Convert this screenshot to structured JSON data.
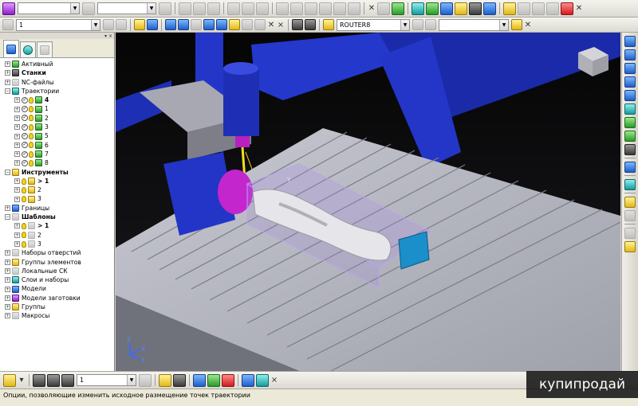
{
  "toolbar_top": {
    "combo_1": "",
    "combo_2": "",
    "combo_3": ""
  },
  "toolbar_second": {
    "level_combo": "1",
    "machine_combo": "ROUTER8",
    "close_glyph": "×"
  },
  "explorer": {
    "header_glyph": "▾ ×",
    "tree": [
      {
        "label": "Активный",
        "bold": false,
        "indent": 0,
        "icon": "active-icon"
      },
      {
        "label": "Станки",
        "bold": true,
        "indent": 0,
        "icon": "machine-icon"
      },
      {
        "label": "NC-файлы",
        "bold": false,
        "indent": 0,
        "icon": "ncfile-icon"
      },
      {
        "label": "Траектории",
        "bold": false,
        "indent": 0,
        "icon": "toolpath-folder-icon",
        "expanded": true
      },
      {
        "label": "4",
        "bold": true,
        "indent": 1,
        "icon": "toolpath-icon"
      },
      {
        "label": "1",
        "bold": false,
        "indent": 1,
        "icon": "toolpath-icon"
      },
      {
        "label": "2",
        "bold": false,
        "indent": 1,
        "icon": "toolpath-icon"
      },
      {
        "label": "3",
        "bold": false,
        "indent": 1,
        "icon": "toolpath-icon"
      },
      {
        "label": "5",
        "bold": false,
        "indent": 1,
        "icon": "toolpath-icon"
      },
      {
        "label": "6",
        "bold": false,
        "indent": 1,
        "icon": "toolpath-icon"
      },
      {
        "label": "7",
        "bold": false,
        "indent": 1,
        "icon": "toolpath-icon"
      },
      {
        "label": "8",
        "bold": false,
        "indent": 1,
        "icon": "toolpath-icon"
      },
      {
        "label": "Инструменты",
        "bold": true,
        "indent": 0,
        "icon": "tool-folder-icon",
        "expanded": true
      },
      {
        "label": "> 1",
        "bold": true,
        "indent": 1,
        "icon": "tool-icon"
      },
      {
        "label": "2",
        "bold": false,
        "indent": 1,
        "icon": "tool-icon"
      },
      {
        "label": "3",
        "bold": false,
        "indent": 1,
        "icon": "tool-icon"
      },
      {
        "label": "Границы",
        "bold": false,
        "indent": 0,
        "icon": "boundary-icon"
      },
      {
        "label": "Шаблоны",
        "bold": true,
        "indent": 0,
        "icon": "pattern-folder-icon",
        "expanded": true
      },
      {
        "label": "> 1",
        "bold": true,
        "indent": 1,
        "icon": "pattern-icon"
      },
      {
        "label": "2",
        "bold": false,
        "indent": 1,
        "icon": "pattern-icon"
      },
      {
        "label": "3",
        "bold": false,
        "indent": 1,
        "icon": "pattern-icon"
      },
      {
        "label": "Наборы отверстий",
        "bold": false,
        "indent": 0,
        "icon": "holeset-icon"
      },
      {
        "label": "Группы элементов",
        "bold": false,
        "indent": 0,
        "icon": "featuregroup-icon"
      },
      {
        "label": "Локальные СК",
        "bold": false,
        "indent": 0,
        "icon": "workplane-icon"
      },
      {
        "label": "Слои и наборы",
        "bold": false,
        "indent": 0,
        "icon": "layers-icon"
      },
      {
        "label": "Модели",
        "bold": false,
        "indent": 0,
        "icon": "model-icon"
      },
      {
        "label": "Модели заготовки",
        "bold": false,
        "indent": 0,
        "icon": "stockmodel-icon"
      },
      {
        "label": "Группы",
        "bold": false,
        "indent": 0,
        "icon": "group-icon"
      },
      {
        "label": "Макросы",
        "bold": false,
        "indent": 0,
        "icon": "macro-icon"
      }
    ]
  },
  "viewport": {
    "axis_labels": {
      "z": "Z",
      "x": "X",
      "y": "Y"
    },
    "toolpath_axis_label": "Y"
  },
  "toolbar_bottom": {
    "level_combo": "1",
    "close_glyph": "×"
  },
  "status": {
    "text": "Опции, позволяющие изменить исходное размещение точек траектории"
  },
  "watermark": {
    "text": "купипродай"
  },
  "colors": {
    "gantry_blue": "#2336c8",
    "table_gray": "#a8a9b4",
    "spindle_magenta": "#c020c8",
    "toolpath_yellow": "#f2e020"
  }
}
